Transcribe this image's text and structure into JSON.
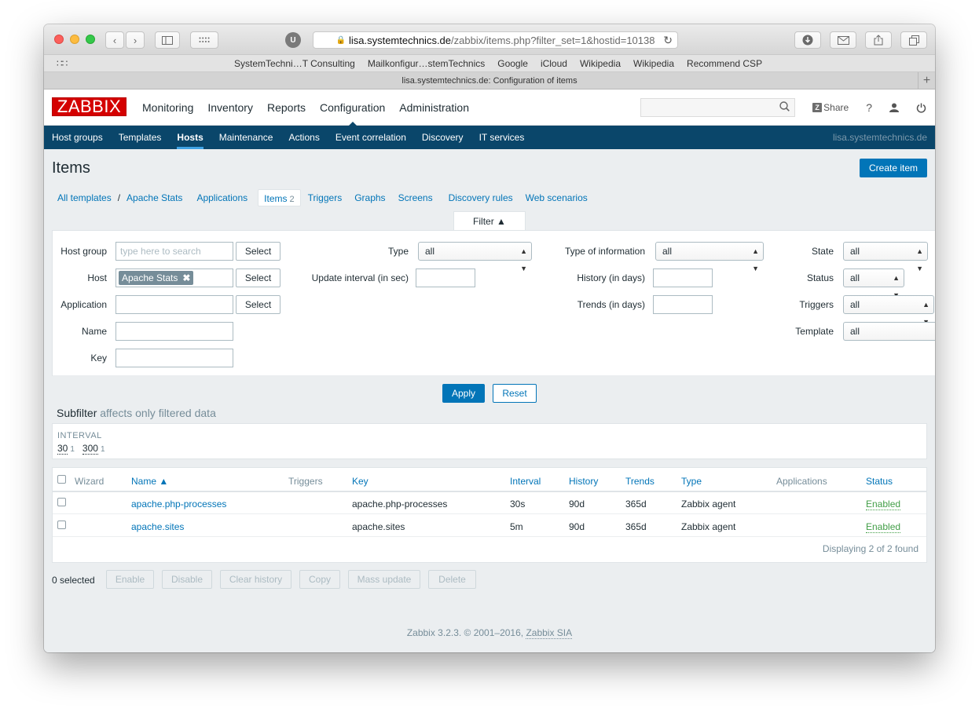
{
  "browser": {
    "url_host": "lisa.systemtechnics.de",
    "url_path": "/zabbix/items.php?filter_set=1&hostid=10138",
    "tab_title": "lisa.systemtechnics.de: Configuration of items",
    "ublock_badge": "U",
    "bookmarks": [
      "SystemTechni…T Consulting",
      "Mailkonfigur…stemTechnics",
      "Google",
      "iCloud",
      "Wikipedia",
      "Wikipedia",
      "Recommend CSP"
    ]
  },
  "header": {
    "logo": "ZABBIX",
    "menu": [
      "Monitoring",
      "Inventory",
      "Reports",
      "Configuration",
      "Administration"
    ],
    "active_menu": "Configuration",
    "search_placeholder": "",
    "share_label": "Share",
    "share_logo": "Z",
    "help_label": "?"
  },
  "submenu": {
    "items": [
      "Host groups",
      "Templates",
      "Hosts",
      "Maintenance",
      "Actions",
      "Event correlation",
      "Discovery",
      "IT services"
    ],
    "active": "Hosts",
    "server_name": "lisa.systemtechnics.de"
  },
  "page": {
    "title": "Items",
    "create_button": "Create item"
  },
  "tabs": {
    "all_templates": "All templates",
    "separator": "/",
    "host": "Apache Stats",
    "applications": "Applications",
    "items": "Items",
    "items_count": "2",
    "triggers": "Triggers",
    "graphs": "Graphs",
    "screens": "Screens",
    "discovery_rules": "Discovery rules",
    "web_scenarios": "Web scenarios"
  },
  "filter": {
    "tab_label": "Filter ▲",
    "host_group_label": "Host group",
    "host_group_placeholder": "type here to search",
    "host_label": "Host",
    "host_chip": "Apache Stats",
    "application_label": "Application",
    "name_label": "Name",
    "key_label": "Key",
    "select_label": "Select",
    "type_label": "Type",
    "type_value": "all",
    "update_interval_label": "Update interval (in sec)",
    "type_info_label": "Type of information",
    "type_info_value": "all",
    "history_label": "History (in days)",
    "trends_label": "Trends (in days)",
    "state_label": "State",
    "state_value": "all",
    "status_label": "Status",
    "status_value": "all",
    "triggers_label": "Triggers",
    "triggers_value": "all",
    "template_label": "Template",
    "template_value": "all",
    "apply": "Apply",
    "reset": "Reset"
  },
  "subfilter": {
    "title": "Subfilter",
    "hint": "affects only filtered data",
    "group_label": "INTERVAL",
    "values": [
      {
        "value": "30",
        "count": "1"
      },
      {
        "value": "300",
        "count": "1"
      }
    ]
  },
  "table": {
    "columns": {
      "wizard": "Wizard",
      "name": "Name ▲",
      "triggers": "Triggers",
      "key": "Key",
      "interval": "Interval",
      "history": "History",
      "trends": "Trends",
      "type": "Type",
      "applications": "Applications",
      "status": "Status"
    },
    "rows": [
      {
        "name": "apache.php-processes",
        "key": "apache.php-processes",
        "interval": "30s",
        "history": "90d",
        "trends": "365d",
        "type": "Zabbix agent",
        "status": "Enabled"
      },
      {
        "name": "apache.sites",
        "key": "apache.sites",
        "interval": "5m",
        "history": "90d",
        "trends": "365d",
        "type": "Zabbix agent",
        "status": "Enabled"
      }
    ],
    "displaying": "Displaying 2 of 2 found"
  },
  "actions": {
    "selected": "0 selected",
    "enable": "Enable",
    "disable": "Disable",
    "clear_history": "Clear history",
    "copy": "Copy",
    "mass_update": "Mass update",
    "delete": "Delete"
  },
  "footer": {
    "text": "Zabbix 3.2.3. © 2001–2016, ",
    "company": "Zabbix SIA"
  }
}
